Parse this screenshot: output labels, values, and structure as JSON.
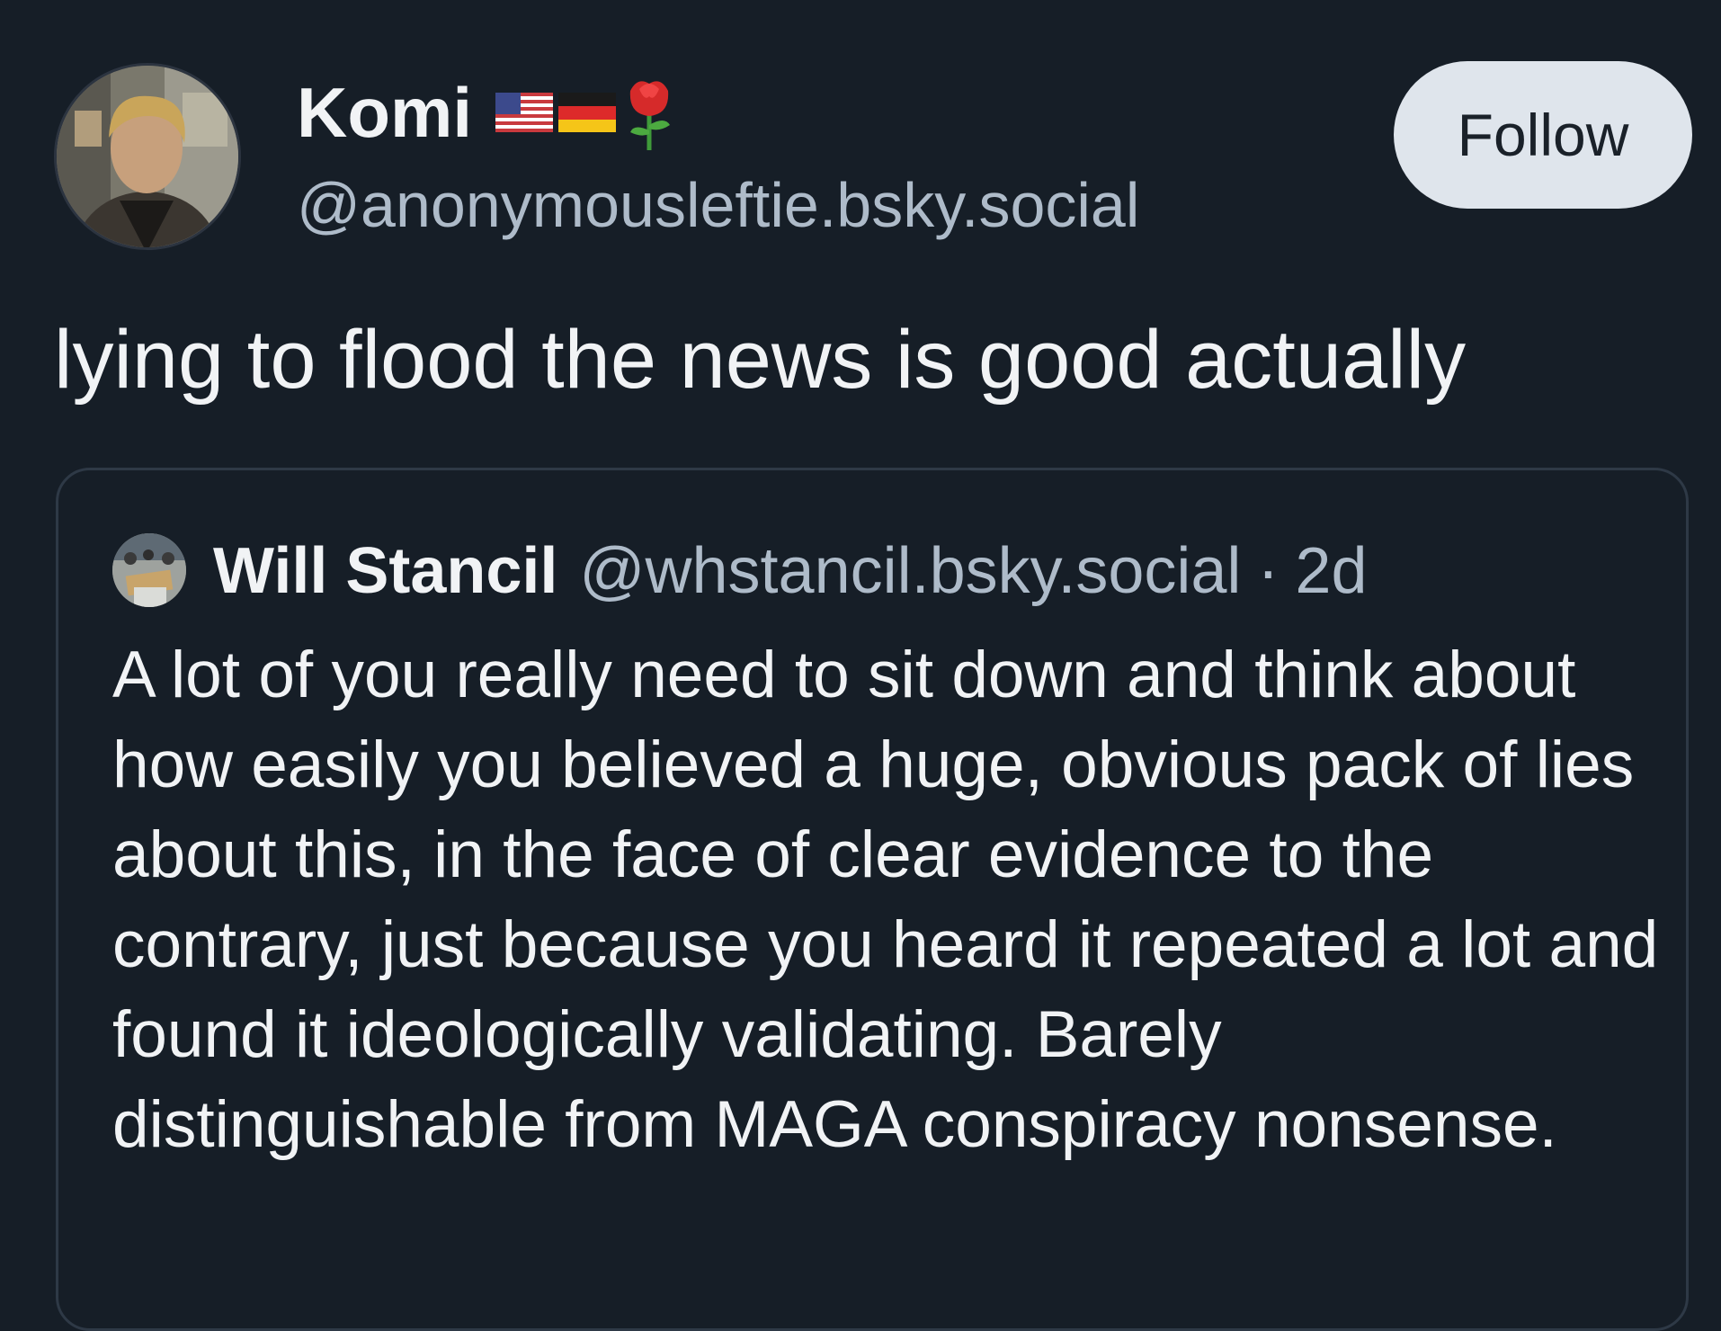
{
  "post": {
    "author": {
      "display_name": "Komi",
      "name_emoji": [
        "flag-us-icon",
        "flag-germany-icon",
        "rose-icon"
      ],
      "handle": "@anonymousleftie.bsky.social"
    },
    "follow_label": "Follow",
    "text": "lying to flood the news is good actually"
  },
  "quote": {
    "author": {
      "display_name": "Will Stancil",
      "handle": "@whstancil.bsky.social"
    },
    "separator": "·",
    "time": "2d",
    "text": "A lot of you really need to sit down and think about how easily you believed a huge, obvious pack of lies about this, in the face of clear evidence to the contrary, just because you heard it repeated a lot and found it ideologically validating. Barely distinguishable from MAGA conspiracy nonsense."
  },
  "colors": {
    "background": "#161e27",
    "text_primary": "#f1f3f5",
    "text_secondary": "#aebbc9",
    "follow_button_bg": "#dfe5ec",
    "card_border": "#2e3946"
  }
}
